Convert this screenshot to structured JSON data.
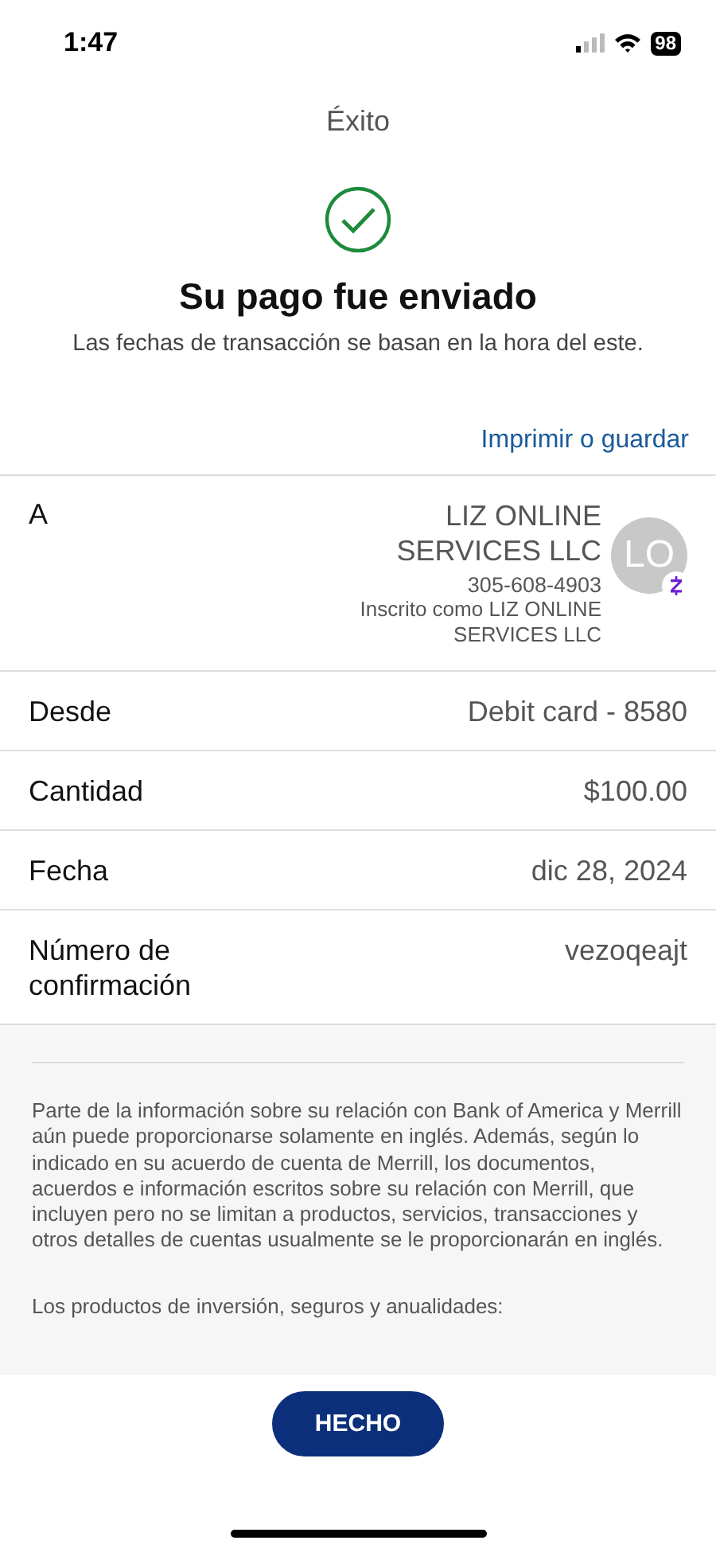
{
  "status_bar": {
    "time": "1:47",
    "battery": "98"
  },
  "title": "Éxito",
  "heading": "Su pago fue enviado",
  "subtitle": "Las fechas de transacción se basan en la hora del este.",
  "print_link": "Imprimir o guardar",
  "recipient": {
    "label": "A",
    "name": "LIZ ONLINE SERVICES LLC",
    "phone": "305-608-4903",
    "enrolled": "Inscrito como LIZ ONLINE SERVICES LLC",
    "initials": "LO"
  },
  "details": [
    {
      "label": "Desde",
      "value": "Debit card - 8580"
    },
    {
      "label": "Cantidad",
      "value": "$100.00"
    },
    {
      "label": "Fecha",
      "value": "dic 28, 2024"
    },
    {
      "label": "Número de confirmación",
      "value": "vezoqeajt"
    }
  ],
  "disclaimer": [
    "Parte de la información sobre su relación con Bank of America y Merrill aún puede proporcionarse solamente en inglés. Además, según lo indicado en su acuerdo de cuenta de Merrill, los documentos, acuerdos e información escritos sobre su relación con Merrill, que incluyen pero no se limitan a productos, servicios, transacciones y otros detalles de cuentas usualmente se le proporcionarán en inglés.",
    "Los productos de inversión, seguros y anualidades:"
  ],
  "done_button": "HECHO"
}
